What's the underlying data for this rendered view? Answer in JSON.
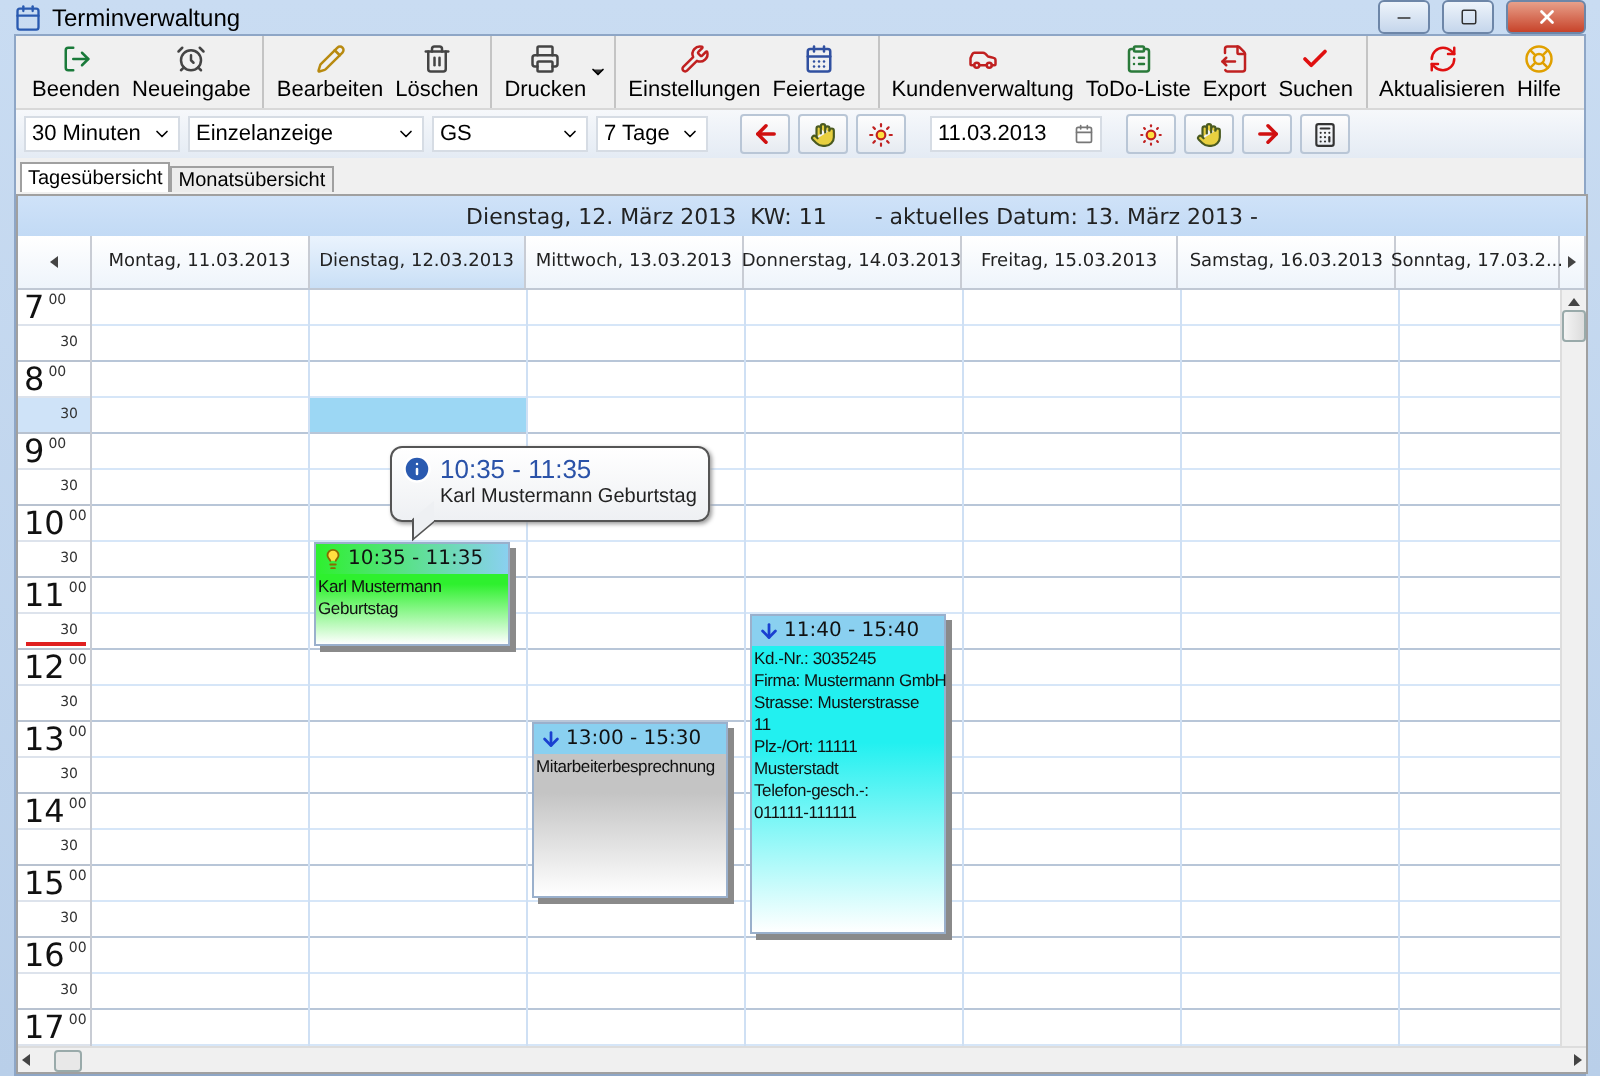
{
  "window": {
    "title": "Terminverwaltung"
  },
  "toolbar_groups": [
    [
      {
        "label": "Beenden",
        "kind": "button"
      },
      {
        "label": "Neueingabe",
        "kind": "button"
      }
    ],
    [
      {
        "label": "Bearbeiten",
        "kind": "button"
      },
      {
        "label": "Löschen",
        "kind": "button"
      }
    ],
    [
      {
        "label": "Drucken",
        "kind": "dropdown"
      }
    ],
    [
      {
        "label": "Einstellungen",
        "kind": "button"
      },
      {
        "label": "Feiertage",
        "kind": "button"
      }
    ],
    [
      {
        "label": "Kundenverwaltung",
        "kind": "button"
      },
      {
        "label": "ToDo-Liste",
        "kind": "button"
      },
      {
        "label": "Export",
        "kind": "button"
      },
      {
        "label": "Suchen",
        "kind": "button"
      }
    ],
    [
      {
        "label": "Aktualisieren",
        "kind": "button"
      },
      {
        "label": "Hilfe",
        "kind": "button"
      }
    ]
  ],
  "filters": [
    {
      "value": "30 Minuten"
    },
    {
      "value": "Einzelanzeige"
    },
    {
      "value": "GS"
    },
    {
      "value": "7 Tage"
    }
  ],
  "date_field": {
    "value": "11.03.2013"
  },
  "tabs": [
    {
      "label": "Tagesübersicht",
      "selected": true
    },
    {
      "label": "Monatsübersicht",
      "selected": false
    }
  ],
  "header": {
    "date": "Dienstag, 12. März 2013  KW: 11",
    "current_date": "- aktuelles Datum: 13. März 2013 -"
  },
  "time_slots": [
    {
      "hour": "7",
      "minute": "00",
      "selected": false
    },
    {
      "minute": "30",
      "selected": false
    },
    {
      "hour": "8",
      "minute": "00",
      "selected": false
    },
    {
      "minute": "30",
      "selected": true
    },
    {
      "hour": "9",
      "minute": "00",
      "selected": false
    },
    {
      "minute": "30",
      "selected": false
    },
    {
      "hour": "10",
      "minute": "00",
      "selected": false
    },
    {
      "minute": "30",
      "selected": false
    },
    {
      "hour": "11",
      "minute": "00",
      "selected": false
    },
    {
      "minute": "30",
      "selected": false
    },
    {
      "hour": "12",
      "minute": "00",
      "selected": false
    },
    {
      "minute": "30",
      "selected": false
    },
    {
      "hour": "13",
      "minute": "00",
      "selected": false
    },
    {
      "minute": "30",
      "selected": false
    },
    {
      "hour": "14",
      "minute": "00",
      "selected": false
    },
    {
      "minute": "30",
      "selected": false
    },
    {
      "hour": "15",
      "minute": "00",
      "selected": false
    },
    {
      "minute": "30",
      "selected": false
    },
    {
      "hour": "16",
      "minute": "00",
      "selected": false
    },
    {
      "minute": "30",
      "selected": false
    },
    {
      "hour": "17",
      "minute": "00",
      "selected": false
    }
  ],
  "days": [
    {
      "label": "Montag, 11.03.2013",
      "selected": false
    },
    {
      "label": "Dienstag, 12.03.2013",
      "selected": true,
      "events": [
        {
          "kind": "reminder",
          "time": "10:35 - 11:35",
          "color": "#2ef02e",
          "lines": [
            "Karl Mustermann",
            "Geburtstag"
          ],
          "tooltip": {
            "time": "10:35 - 11:35",
            "text": "Karl Mustermann Geburtstag"
          }
        }
      ]
    },
    {
      "label": "Mittwoch, 13.03.2013",
      "selected": false,
      "events": [
        {
          "kind": "appointment",
          "time": "13:00 - 15:30",
          "color": "#c4c4c4",
          "lines": [
            "Mitarbeiterbesprechnung"
          ]
        }
      ]
    },
    {
      "label": "Donnerstag, 14.03.2013",
      "selected": false,
      "events": [
        {
          "kind": "appointment",
          "time": "11:40 - 15:40",
          "color": "#22f0f0",
          "lines": [
            "Kd.-Nr.: 3035245",
            "Firma: Mustermann GmbH",
            "Strasse: Musterstrasse",
            "11",
            "Plz-/Ort: 11111",
            "Musterstadt",
            "Telefon-gesch.-:",
            "011111-111111"
          ]
        }
      ]
    },
    {
      "label": "Freitag, 15.03.2013",
      "selected": false
    },
    {
      "label": "Samstag, 16.03.2013",
      "selected": false
    },
    {
      "label": "Sonntag, 17.03.2...",
      "selected": false
    }
  ]
}
